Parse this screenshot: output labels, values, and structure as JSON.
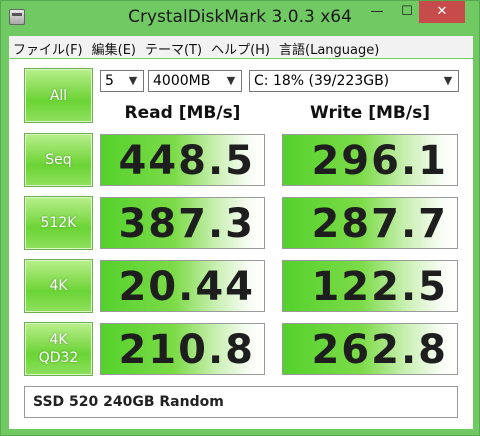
{
  "window": {
    "title": "CrystalDiskMark 3.0.3 x64",
    "minimize_label": "—",
    "maximize_label": "☐",
    "close_label": "✕"
  },
  "menu": {
    "items": [
      "ファイル(F)",
      "編集(E)",
      "テーマ(T)",
      "ヘルプ(H)",
      "言語(Language)"
    ]
  },
  "controls": {
    "all_label": "All",
    "count": "5",
    "size": "4000MB",
    "drive": "C: 18% (39/223GB)"
  },
  "headers": {
    "read": "Read [MB/s]",
    "write": "Write [MB/s]"
  },
  "rows": [
    {
      "label": "Seq",
      "read": "448.5",
      "write": "296.1"
    },
    {
      "label": "512K",
      "read": "387.3",
      "write": "287.7"
    },
    {
      "label": "4K",
      "read": "20.44",
      "write": "122.5"
    },
    {
      "label_line1": "4K",
      "label_line2": "QD32",
      "read": "210.8",
      "write": "262.8"
    }
  ],
  "comment": "SSD 520 240GB Random",
  "colors": {
    "window_green": "#70c963",
    "button_green": "#6bd435",
    "close_red": "#c74b4b"
  }
}
